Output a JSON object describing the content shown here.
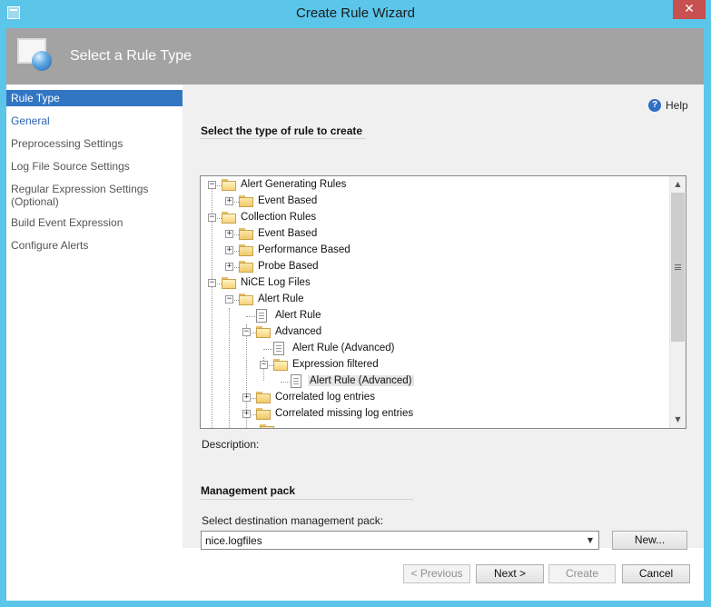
{
  "window": {
    "title": "Create Rule Wizard",
    "close_glyph": "✕"
  },
  "header": {
    "title": "Select a Rule Type"
  },
  "nav": {
    "items": [
      {
        "label": "Rule Type",
        "state": "active"
      },
      {
        "label": "General",
        "state": "link"
      },
      {
        "label": "Preprocessing Settings",
        "state": "normal"
      },
      {
        "label": "Log File Source Settings",
        "state": "normal"
      },
      {
        "label": "Regular Expression Settings\n(Optional)",
        "state": "normal"
      },
      {
        "label": "Build Event Expression",
        "state": "normal"
      },
      {
        "label": "Configure Alerts",
        "state": "normal"
      }
    ]
  },
  "help": {
    "label": "Help",
    "icon": "question-mark-icon"
  },
  "rule_type": {
    "heading": "Select the type of rule to create",
    "tree": [
      {
        "label": "Alert Generating Rules",
        "level": 0,
        "kind": "folder-open",
        "expander": "minus"
      },
      {
        "label": "Event Based",
        "level": 1,
        "kind": "folder",
        "expander": "plus"
      },
      {
        "label": "Collection Rules",
        "level": 0,
        "kind": "folder-open",
        "expander": "minus"
      },
      {
        "label": "Event Based",
        "level": 1,
        "kind": "folder",
        "expander": "plus"
      },
      {
        "label": "Performance Based",
        "level": 1,
        "kind": "folder",
        "expander": "plus"
      },
      {
        "label": "Probe Based",
        "level": 1,
        "kind": "folder",
        "expander": "plus"
      },
      {
        "label": "NiCE Log Files",
        "level": 0,
        "kind": "folder-open",
        "expander": "minus"
      },
      {
        "label": "Alert Rule",
        "level": 1,
        "kind": "folder-open",
        "expander": "minus"
      },
      {
        "label": "Alert Rule",
        "level": 2,
        "kind": "doc",
        "expander": "none"
      },
      {
        "label": "Advanced",
        "level": 2,
        "kind": "folder-open",
        "expander": "minus"
      },
      {
        "label": "Alert Rule (Advanced)",
        "level": 3,
        "kind": "doc",
        "expander": "none"
      },
      {
        "label": "Expression filtered",
        "level": 3,
        "kind": "folder-open",
        "expander": "minus"
      },
      {
        "label": "Alert Rule (Advanced)",
        "level": 4,
        "kind": "doc",
        "expander": "none",
        "selected": true
      },
      {
        "label": "Correlated log entries",
        "level": 2,
        "kind": "folder",
        "expander": "plus"
      },
      {
        "label": "Correlated missing log entries",
        "level": 2,
        "kind": "folder",
        "expander": "plus"
      }
    ],
    "description_label": "Description:"
  },
  "management_pack": {
    "heading": "Management pack",
    "select_label": "Select destination management pack:",
    "selected_value": "nice.logfiles",
    "new_button": "New..."
  },
  "footer": {
    "previous": "< Previous",
    "next": "Next >",
    "create": "Create",
    "cancel": "Cancel"
  }
}
